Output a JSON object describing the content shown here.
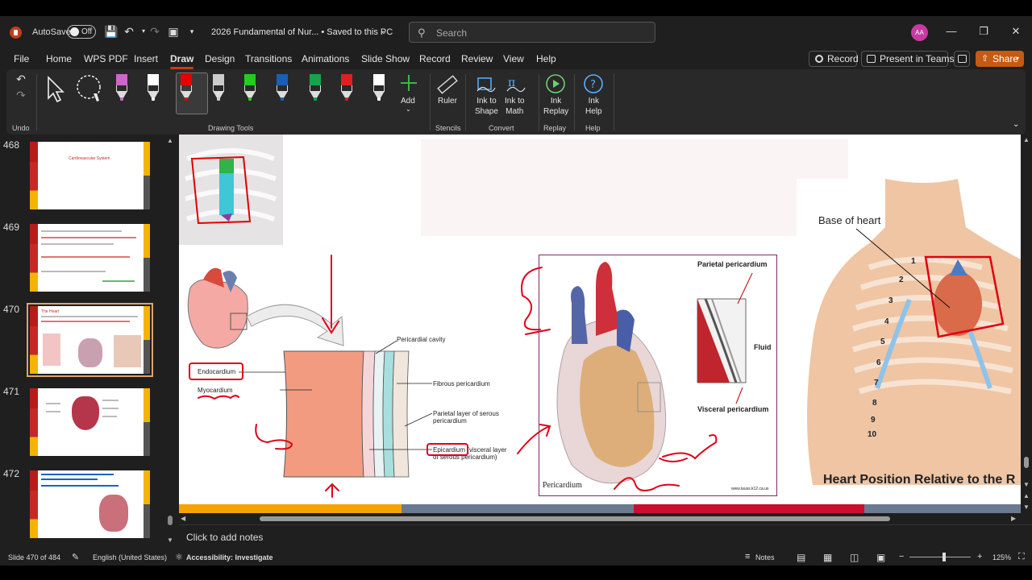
{
  "titlebar": {
    "autosave_label": "AutoSave",
    "autosave_state": "Off",
    "doc_title": "2026 Fundamental of Nur...  •  Saved to this PC",
    "search_placeholder": "Search",
    "avatar_initials": "AA"
  },
  "menu": {
    "tabs": [
      "File",
      "Home",
      "WPS PDF",
      "Insert",
      "Draw",
      "Design",
      "Transitions",
      "Animations",
      "Slide Show",
      "Record",
      "Review",
      "View",
      "Help"
    ],
    "active_tab": "Draw",
    "record_label": "Record",
    "present_label": "Present in Teams",
    "share_label": "Share"
  },
  "ribbon": {
    "undo_group": "Undo",
    "drawing_tools_group": "Drawing Tools",
    "add_label": "Add",
    "ruler_label": "Ruler",
    "stencils_group": "Stencils",
    "ink_to_shape_label": "Ink to\nShape",
    "ink_to_math_label": "Ink to\nMath",
    "convert_group": "Convert",
    "ink_replay_label": "Ink\nReplay",
    "replay_group": "Replay",
    "ink_help_label": "Ink\nHelp",
    "help_group": "Help",
    "pen_colors": [
      "#cc66cc",
      "#ffffff",
      "#e60000",
      "#cccccc",
      "#22cc22",
      "#1a5fb4",
      "#16a34a",
      "#e02020",
      "#ffffff"
    ]
  },
  "thumbnails": [
    {
      "number": "468",
      "title": "Cardiovascular System"
    },
    {
      "number": "469",
      "title": ""
    },
    {
      "number": "470",
      "title": "The Heart"
    },
    {
      "number": "471",
      "title": ""
    },
    {
      "number": "472",
      "title": ""
    }
  ],
  "slide": {
    "labels": {
      "pericardial_cavity": "Pericardial cavity",
      "endocardium": "Endocardium",
      "myocardium": "Myocardium",
      "fibrous_pericardium": "Fibrous pericardium",
      "parietal_serous": "Parietal layer of serous\npericardium",
      "epicardium": "Epicardium (visceral layer\nof serous pericardium)",
      "parietal_pericardium": "Parietal pericardium",
      "fluid": "Fluid",
      "visceral_pericardium": "Visceral pericardium",
      "pericardium": "Pericardium",
      "website": "www.lauss.k12.ca.us",
      "base_of_heart": "Base of heart",
      "heart_position_caption": "Heart Position Relative to the R"
    },
    "rib_numbers": [
      "1",
      "2",
      "3",
      "4",
      "5",
      "6",
      "7",
      "8",
      "9",
      "10"
    ],
    "stripe_colors": [
      "#f5a300",
      "#6b7a90",
      "#c8102e",
      "#6b7a90"
    ]
  },
  "notes_placeholder": "Click to add notes",
  "status": {
    "slide_counter": "Slide 470 of 484",
    "language": "English (United States)",
    "accessibility": "Accessibility: Investigate",
    "notes_label": "Notes",
    "zoom": "125%"
  }
}
